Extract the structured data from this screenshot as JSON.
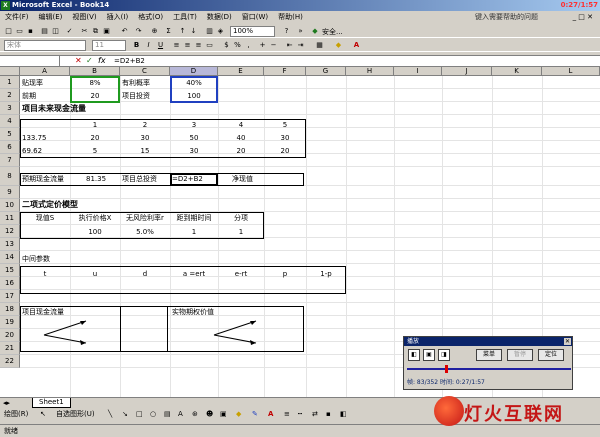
{
  "window": {
    "title": "Microsoft Excel - Book14",
    "clock": "0:27/1:57"
  },
  "menu": {
    "items": [
      "文件(F)",
      "编辑(E)",
      "视图(V)",
      "插入(I)",
      "格式(O)",
      "工具(T)",
      "数据(D)",
      "窗口(W)",
      "帮助(H)"
    ],
    "help_placeholder": "键入需要帮助的问题"
  },
  "toolbar": {
    "zoom": "100%",
    "safety": "安全..."
  },
  "formatbar": {
    "font": "宋体",
    "size": "11",
    "bold": "B",
    "italic": "I",
    "underline": "U"
  },
  "formula": {
    "fx": "fx",
    "cancel": "✕",
    "accept": "✓",
    "content": "=D2+B2"
  },
  "columns": [
    "A",
    "B",
    "C",
    "D",
    "E",
    "F",
    "G",
    "H",
    "I",
    "J",
    "K",
    "L"
  ],
  "rows": [
    "1",
    "2",
    "3",
    "4",
    "5",
    "6",
    "7",
    "8",
    "9",
    "10",
    "11",
    "12",
    "13",
    "14",
    "15",
    "16",
    "17",
    "18",
    "19",
    "20",
    "21",
    "22"
  ],
  "cells": {
    "a1": "贴现率",
    "b1": "8%",
    "c1": "有利概率",
    "d1": "40%",
    "a2": "前期",
    "b2": "20",
    "c2": "项目投资",
    "d2": "100",
    "a3": "项目未来现金流量",
    "b4": "1",
    "c4": "2",
    "d4": "3",
    "e4": "4",
    "f4": "5",
    "a5": "133.75",
    "b5": "20",
    "c5": "30",
    "d5": "50",
    "e5": "40",
    "f5": "30",
    "a6": "69.62",
    "b6": "5",
    "c6": "15",
    "d6": "30",
    "e6": "20",
    "f6": "20",
    "a8": "预期现金流量",
    "b8": "81.35",
    "c8": "项目总投资",
    "d8": "=D2+B2",
    "e8": "净现值",
    "a10": "二项式定价模型",
    "a11": "现值S",
    "b11": "执行价格X",
    "c11": "无风险利率r",
    "d11": "距到期时间",
    "e11": "分项",
    "b12": "100",
    "c12": "5.0%",
    "d12": "1",
    "e12": "1",
    "a14": "中间参数",
    "a15": "t",
    "b15": "u",
    "c15": "d",
    "d15": "a =ert",
    "e15": "e-rt",
    "f15": "p",
    "g15": "1-p",
    "a18": "项目现金流量",
    "d18": "实物期权价值"
  },
  "sheet": {
    "tab": "Sheet1"
  },
  "drawbar": {
    "draw": "绘图(R)",
    "autoshape": "自选图形(U)"
  },
  "status": {
    "text": "就绪"
  },
  "player": {
    "title": "播放",
    "menu": "菜单",
    "disabled": "暂停",
    "locate": "定位",
    "frame": "帧: 83/352 时间: 0:27/1:57",
    "progress": 0.24
  },
  "watermark": {
    "text": "灯火互联网"
  }
}
